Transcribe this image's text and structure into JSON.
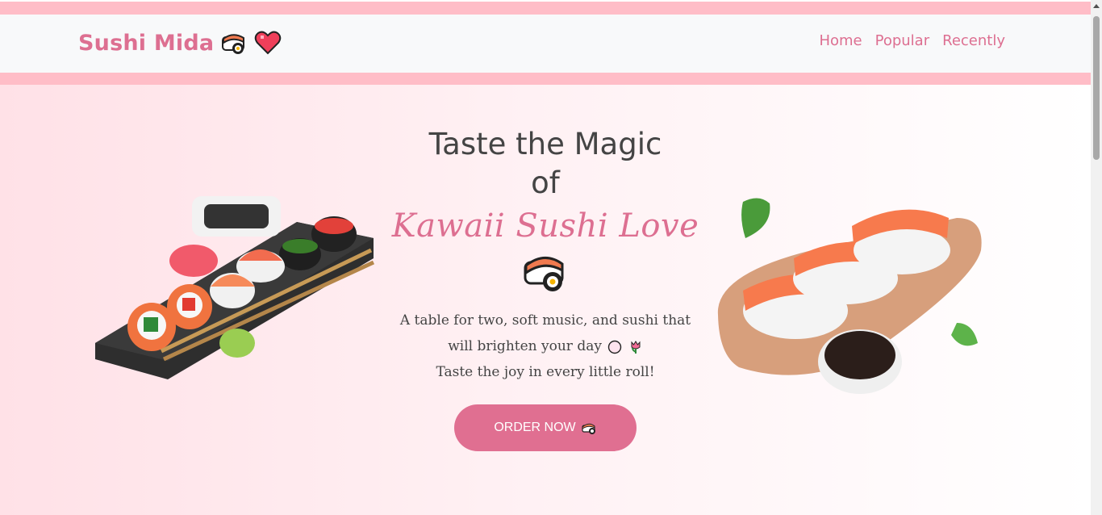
{
  "header": {
    "brand": "Sushi Mida",
    "nav": [
      "Home",
      "Popular",
      "Recently"
    ]
  },
  "hero": {
    "title_line1": "Taste the Magic",
    "title_line2": "of",
    "title_script": "Kawaii Sushi Love",
    "tagline_line1": "A table for two, soft music, and sushi that",
    "tagline_line2": "will brighten your day",
    "tagline_line3": "Taste the joy in every little roll!",
    "cta": "ORDER NOW"
  },
  "colors": {
    "accent": "#dd6f91",
    "strip": "#ffbdc7",
    "header_bg": "#f8f9fa",
    "text": "#444444"
  },
  "icons": [
    "sushi-icon",
    "heart-icon",
    "plate-icon",
    "tulip-icon"
  ]
}
